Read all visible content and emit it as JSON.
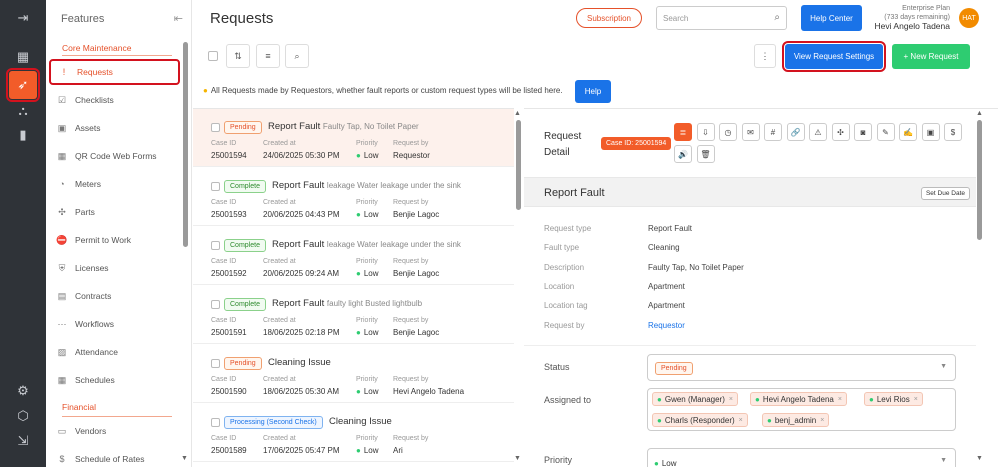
{
  "rail": {
    "icons": [
      "collapse-icon",
      "grid-icon",
      "rocket-icon",
      "sitemap-icon",
      "chart-icon",
      "gear-icon",
      "box-icon",
      "exit-icon"
    ]
  },
  "features": {
    "title": "Features",
    "sections": {
      "core": "Core Maintenance",
      "financial": "Financial"
    },
    "items": [
      {
        "label": "Requests",
        "icon": "alert-icon"
      },
      {
        "label": "Checklists",
        "icon": "checklist-icon"
      },
      {
        "label": "Assets",
        "icon": "asset-icon"
      },
      {
        "label": "QR Code Web Forms",
        "icon": "qr-icon"
      },
      {
        "label": "Meters",
        "icon": "meter-icon"
      },
      {
        "label": "Parts",
        "icon": "parts-icon"
      },
      {
        "label": "Permit to Work",
        "icon": "permit-icon"
      },
      {
        "label": "Licenses",
        "icon": "shield-icon"
      },
      {
        "label": "Contracts",
        "icon": "document-icon"
      },
      {
        "label": "Workflows",
        "icon": "workflow-icon"
      },
      {
        "label": "Attendance",
        "icon": "attendance-icon"
      },
      {
        "label": "Schedules",
        "icon": "calendar-icon"
      }
    ],
    "financial_items": [
      {
        "label": "Vendors",
        "icon": "vendor-icon"
      },
      {
        "label": "Schedule of Rates",
        "icon": "dollar-icon"
      }
    ]
  },
  "header": {
    "title": "Requests",
    "subscription": "Subscription",
    "search_placeholder": "Search",
    "help_center": "Help Center",
    "plan": "Enterprise Plan",
    "plan_days": "(733 days remaining)",
    "user_name": "Hevi Angelo Tadena",
    "avatar": "HAT"
  },
  "toolbar": {
    "view_settings": "View Request Settings",
    "new_request": "+ New Request",
    "more": "⋮"
  },
  "info": {
    "text": "All Requests made by Requestors, whether fault reports or custom request types will be listed here.",
    "help": "Help"
  },
  "list_labels": {
    "case_id": "Case ID",
    "created_at": "Created at",
    "priority": "Priority",
    "request_by": "Request by"
  },
  "requests": [
    {
      "status": "Pending",
      "status_class": "pending",
      "title": "Report Fault",
      "desc": "Faulty Tap, No Toilet Paper",
      "case_id": "25001594",
      "created": "24/06/2025 05:30 PM",
      "priority": "Low",
      "by": "Requestor"
    },
    {
      "status": "Complete",
      "status_class": "complete",
      "title": "Report Fault",
      "desc": "leakage Water leakage under the sink",
      "case_id": "25001593",
      "created": "20/06/2025 04:43 PM",
      "priority": "Low",
      "by": "Benjie Lagoc"
    },
    {
      "status": "Complete",
      "status_class": "complete",
      "title": "Report Fault",
      "desc": "leakage Water leakage under the sink",
      "case_id": "25001592",
      "created": "20/06/2025 09:24 AM",
      "priority": "Low",
      "by": "Benjie Lagoc"
    },
    {
      "status": "Complete",
      "status_class": "complete",
      "title": "Report Fault",
      "desc": "faulty light Busted lightbulb",
      "case_id": "25001591",
      "created": "18/06/2025 02:18 PM",
      "priority": "Low",
      "by": "Benjie Lagoc"
    },
    {
      "status": "Pending",
      "status_class": "pending",
      "title": "Cleaning Issue",
      "desc": "",
      "case_id": "25001590",
      "created": "18/06/2025 05:30 AM",
      "priority": "Low",
      "by": "Hevi Angelo Tadena"
    },
    {
      "status": "Processing (Second Check)",
      "status_class": "processing",
      "title": "Cleaning Issue",
      "desc": "",
      "case_id": "25001589",
      "created": "17/06/2025 05:47 PM",
      "priority": "Low",
      "by": "Ari"
    }
  ],
  "detail": {
    "label_line1": "Request",
    "label_line2": "Detail",
    "case_badge": "Case ID: 25001594",
    "section_title": "Report Fault",
    "set_due": "Set Due Date",
    "fields": [
      {
        "label": "Request type",
        "value": "Report Fault"
      },
      {
        "label": "Fault type",
        "value": "Cleaning"
      },
      {
        "label": "Description",
        "value": "Faulty Tap, No Toilet Paper"
      },
      {
        "label": "Location",
        "value": "Apartment"
      },
      {
        "label": "Location tag",
        "value": "Apartment"
      },
      {
        "label": "Request by",
        "value": "Requestor"
      }
    ],
    "status_label": "Status",
    "status_value": "Pending",
    "assigned_label": "Assigned to",
    "assignees": [
      "Gwen (Manager)",
      "Hevi Angelo Tadena",
      "Levi Rios",
      "Charls (Responder)",
      "benj_admin"
    ],
    "priority_label": "Priority",
    "priority_value": "Low",
    "actions": [
      "notes-icon",
      "download-icon",
      "clock-icon",
      "chat-icon",
      "hash-icon",
      "link-icon",
      "warning-icon",
      "puzzle-icon",
      "camera-icon",
      "edit-icon",
      "signature-icon",
      "truck-icon",
      "dollar-icon",
      "volume-icon",
      "trash-icon"
    ],
    "action_glyphs": [
      "≣",
      "⇩",
      "◷",
      "✉",
      "#",
      "🔗",
      "⚠",
      "✣",
      "◙",
      "✎",
      "✍",
      "▣",
      "$",
      "🔊",
      "🗑"
    ]
  },
  "colors": {
    "accent": "#f25c29",
    "primary": "#1a73e8",
    "success": "#2ecc71",
    "highlight": "#d3121e",
    "rail": "#2f3338"
  }
}
